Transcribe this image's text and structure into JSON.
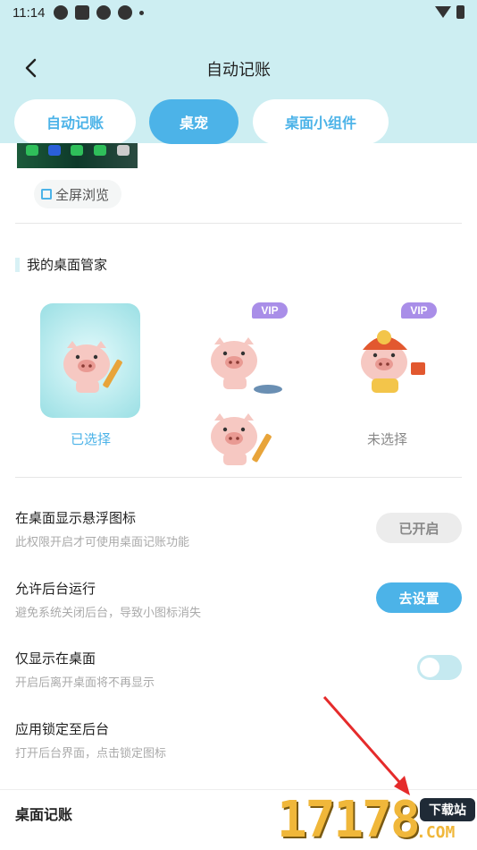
{
  "status_bar": {
    "time": "11:14"
  },
  "nav": {
    "title": "自动记账"
  },
  "tabs": [
    {
      "label": "自动记账",
      "active": false
    },
    {
      "label": "桌宠",
      "active": true
    },
    {
      "label": "桌面小组件",
      "active": false
    }
  ],
  "preview": {
    "fullscreen_label": "全屏浏览"
  },
  "manager": {
    "title": "我的桌面管家",
    "pets": [
      {
        "status": "已选择",
        "vip": false,
        "selected": true
      },
      {
        "status": "",
        "vip": true,
        "vip_label": "VIP",
        "selected": false
      },
      {
        "status": "未选择",
        "vip": true,
        "vip_label": "VIP",
        "selected": false
      },
      {
        "status": "",
        "vip": false,
        "selected": false
      }
    ]
  },
  "settings": [
    {
      "title": "在桌面显示悬浮图标",
      "subtitle": "此权限开启才可使用桌面记账功能",
      "action": "已开启"
    },
    {
      "title": "允许后台运行",
      "subtitle": "避免系统关闭后台，导致小图标消失",
      "action": "去设置"
    },
    {
      "title": "仅显示在桌面",
      "subtitle": "开启后离开桌面将不再显示",
      "toggle_on": false
    },
    {
      "title": "应用锁定至后台",
      "subtitle": "打开后台界面，点击锁定图标"
    }
  ],
  "bottom": {
    "title": "桌面记账"
  },
  "watermark": {
    "number": "17178",
    "site": "下载站",
    "domain": ".COM"
  },
  "colors": {
    "accent": "#4cb3e8",
    "header_bg": "#cdeef2",
    "vip": "#a98ee8"
  }
}
